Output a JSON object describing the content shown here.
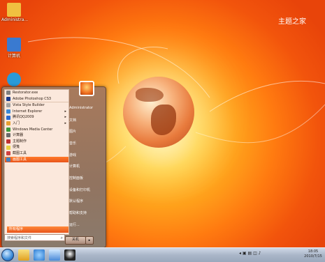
{
  "desktop": {
    "icons": [
      {
        "label": "Administra...",
        "color": "#f0c040",
        "icon": "folder-icon"
      },
      {
        "label": "计算机",
        "color": "#3a7ad0",
        "icon": "computer-icon"
      },
      {
        "label": "",
        "color": "#2a9ad8",
        "icon": "network-icon"
      }
    ],
    "brand": "主题之家"
  },
  "start_menu": {
    "programs": [
      {
        "label": "Restorator.exe",
        "color": "#808080",
        "arrow": ""
      },
      {
        "label": "Adobe Photoshop CS3",
        "color": "#1a3a8a",
        "arrow": ""
      },
      {
        "label": "Vista Style Builder",
        "color": "#a0a0a0",
        "arrow": ""
      },
      {
        "label": "Internet Explorer",
        "color": "#3a8ad8",
        "arrow": "▸"
      },
      {
        "label": "腾讯QQ2009",
        "color": "#2a6ad0",
        "arrow": "▸"
      },
      {
        "label": "入门",
        "color": "#e8a030",
        "arrow": "▸"
      },
      {
        "label": "Windows Media Center",
        "color": "#3a9a3a",
        "arrow": ""
      },
      {
        "label": "计算器",
        "color": "#6a6a6a",
        "arrow": ""
      },
      {
        "label": "主题制作",
        "color": "#c03030",
        "arrow": ""
      },
      {
        "label": "便笺",
        "color": "#e8d040",
        "arrow": ""
      },
      {
        "label": "截图工具",
        "color": "#d04040",
        "arrow": ""
      },
      {
        "label": "画图工具",
        "color": "#4080c0",
        "arrow": ""
      }
    ],
    "all_programs": "所有程序",
    "search_placeholder": "搜索程序和文件",
    "right_items": [
      "Administrator",
      "文档",
      "图片",
      "音乐",
      "游戏",
      "计算机",
      "控制面板",
      "设备和打印机",
      "默认程序",
      "帮助和支持",
      "运行..."
    ],
    "shutdown_label": "关机"
  },
  "taskbar": {
    "tray_text": "◂ ▣ ▤ ◫ ♪",
    "time": "18:05",
    "date": "2010/7/15"
  }
}
